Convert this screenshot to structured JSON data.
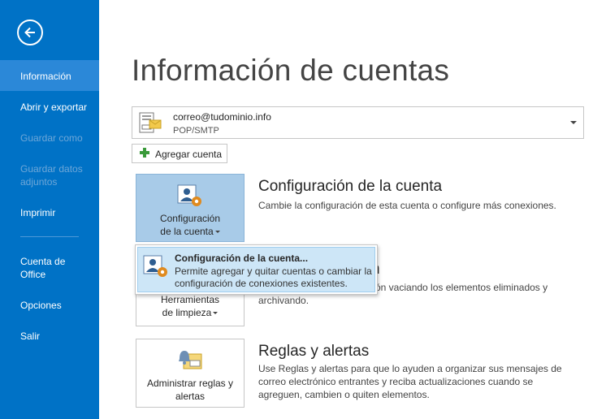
{
  "sidebar": {
    "items": [
      {
        "label": "Información"
      },
      {
        "label": "Abrir y exportar"
      },
      {
        "label": "Guardar como"
      },
      {
        "label": "Guardar datos adjuntos"
      },
      {
        "label": "Imprimir"
      },
      {
        "label": "Cuenta de Office"
      },
      {
        "label": "Opciones"
      },
      {
        "label": "Salir"
      }
    ]
  },
  "page": {
    "title": "Información de cuentas"
  },
  "account": {
    "email": "correo@tudominio.info",
    "type": "POP/SMTP"
  },
  "add_account": {
    "label": "Agregar cuenta"
  },
  "sections": [
    {
      "tile_label_1": "Configuración",
      "tile_label_2": "de la cuenta",
      "title": "Configuración de la cuenta",
      "desc": "Cambie la configuración de esta cuenta o configure más conexiones."
    },
    {
      "tile_label_1": "Herramientas",
      "tile_label_2": "de limpieza",
      "title": "n",
      "desc_line1": "zón vaciando los elementos eliminados y",
      "desc_line2": "archivando."
    },
    {
      "tile_label_1": "Administrar reglas y",
      "tile_label_2": "alertas",
      "title": "Reglas y alertas",
      "desc": "Use Reglas y alertas para que lo ayuden a organizar sus mensajes de correo electrónico entrantes y reciba actualizaciones cuando se agreguen, cambien o quiten elementos."
    }
  ],
  "dropdown_menu": {
    "item_title": "Configuración de la cuenta...",
    "item_desc": "Permite agregar y quitar cuentas o cambiar la configuración de conexiones existentes."
  },
  "colors": {
    "sidebar": "#0072c6",
    "selected": "#2b88d8",
    "tile_active": "#a8cbe8",
    "menu_highlight": "#cde6f7"
  },
  "icons": [
    "back-arrow-icon",
    "account-icon",
    "plus-icon",
    "account-settings-icon",
    "rules-alerts-icon"
  ]
}
